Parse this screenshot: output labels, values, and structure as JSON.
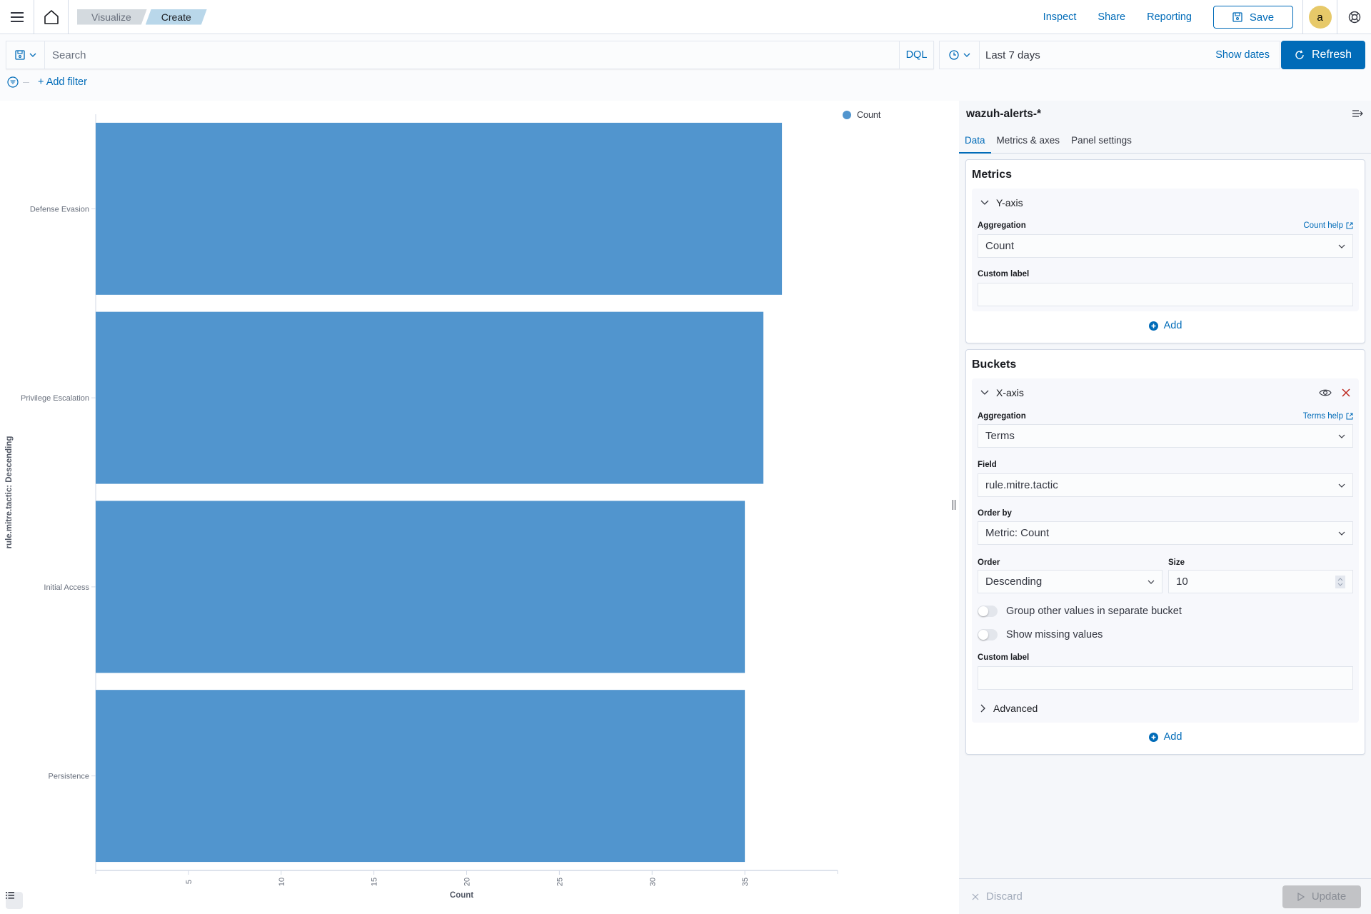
{
  "header": {
    "breadcrumbs": [
      "Visualize",
      "Create"
    ],
    "links": {
      "inspect": "Inspect",
      "share": "Share",
      "reporting": "Reporting"
    },
    "save_label": "Save",
    "avatar_initial": "a",
    "icons": {
      "menu": "hamburger-icon",
      "home": "home-icon",
      "save": "save-icon",
      "help": "help-lifebuoy-icon"
    }
  },
  "query": {
    "placeholder": "Search",
    "value": "",
    "language": "DQL",
    "time_range": "Last 7 days",
    "show_dates": "Show dates",
    "refresh_label": "Refresh",
    "add_filter": "+ Add filter"
  },
  "chart_data": {
    "type": "bar",
    "orientation": "horizontal",
    "categories": [
      "Defense Evasion",
      "Privilege Escalation",
      "Initial Access",
      "Persistence"
    ],
    "series": [
      {
        "name": "Count",
        "values": [
          37,
          36,
          35,
          35
        ],
        "color": "#5195ce"
      }
    ],
    "xlabel": "Count",
    "ylabel": "rule.mitre.tactic: Descending",
    "xlim": [
      0,
      40
    ],
    "xticks": [
      5,
      10,
      15,
      20,
      25,
      30,
      35
    ],
    "legend": {
      "entries": [
        "Count"
      ],
      "placement": "top-right"
    },
    "grid": false
  },
  "side": {
    "index_pattern": "wazuh-alerts-*",
    "tabs": [
      "Data",
      "Metrics & axes",
      "Panel settings"
    ],
    "active_tab": "Data",
    "metrics": {
      "title": "Metrics",
      "agg_title": "Y-axis",
      "aggregation_label": "Aggregation",
      "help_link": "Count help",
      "aggregation": "Count",
      "custom_label_label": "Custom label",
      "custom_label": "",
      "add_label": "Add"
    },
    "buckets": {
      "title": "Buckets",
      "agg_title": "X-axis",
      "aggregation_label": "Aggregation",
      "help_link": "Terms help",
      "aggregation": "Terms",
      "field_label": "Field",
      "field": "rule.mitre.tactic",
      "order_by_label": "Order by",
      "order_by": "Metric: Count",
      "order_label": "Order",
      "order": "Descending",
      "size_label": "Size",
      "size": "10",
      "group_other_label": "Group other values in separate bucket",
      "group_other": false,
      "show_missing_label": "Show missing values",
      "show_missing": false,
      "custom_label_label": "Custom label",
      "custom_label": "",
      "advanced_label": "Advanced",
      "add_label": "Add"
    },
    "footer": {
      "discard": "Discard",
      "update": "Update"
    }
  }
}
